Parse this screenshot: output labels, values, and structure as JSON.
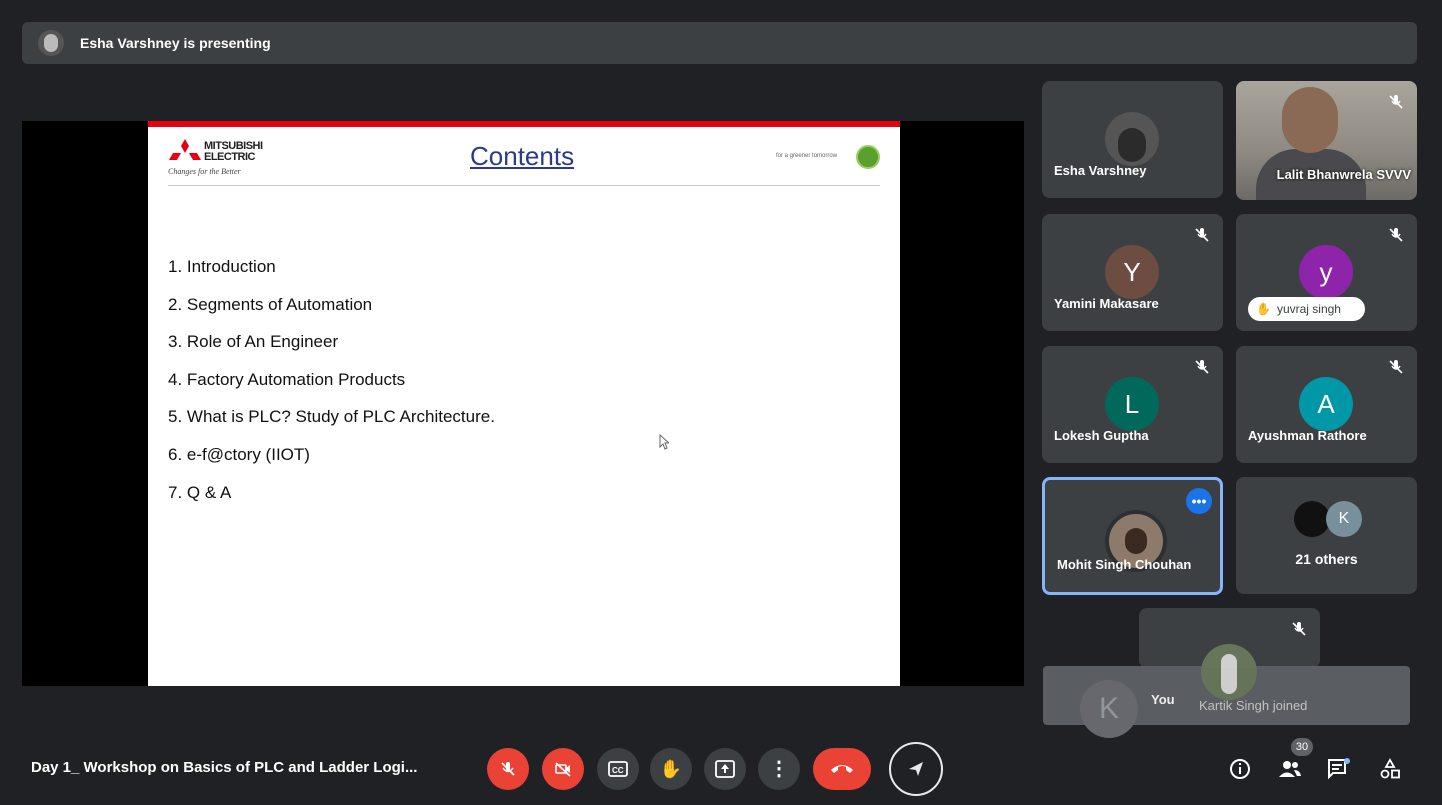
{
  "banner": {
    "presenting_text": "Esha Varshney is presenting"
  },
  "slide": {
    "logo_line1": "MITSUBISHI",
    "logo_line2": "ELECTRIC",
    "logo_tagline": "Changes for the Better",
    "title": "Contents",
    "eco_tagline": "for a greener tomorrow",
    "items": [
      "1. Introduction",
      "2. Segments of Automation",
      "3. Role of An Engineer",
      "4. Factory Automation Products",
      "5. What is PLC? Study of PLC Architecture.",
      "6. e-f@ctory (IIOT)",
      "7. Q & A"
    ]
  },
  "participants": {
    "esha": {
      "name": "Esha Varshney"
    },
    "lalit": {
      "name": "Lalit Bhanwrela SVVV"
    },
    "yamini": {
      "name": "Yamini Makasare",
      "initial": "Y",
      "color": "#6d4c41"
    },
    "yuvraj": {
      "name": "yuvraj singh",
      "initial": "y",
      "color": "#8e24aa"
    },
    "lokesh": {
      "name": "Lokesh Guptha",
      "initial": "L",
      "color": "#00695c"
    },
    "ayushman": {
      "name": "Ayushman Rathore",
      "initial": "A",
      "color": "#0097a7"
    },
    "mohit": {
      "name": "Mohit Singh Chouhan"
    },
    "others": {
      "label": "21 others",
      "initial": "K"
    },
    "self": {
      "label": "You",
      "initial": "K"
    }
  },
  "toast": {
    "text": "Kartik Singh joined"
  },
  "bottom": {
    "meeting_title": "Day 1_ Workshop on Basics of PLC and Ladder Logi...",
    "participant_count": "30"
  },
  "colors": {
    "accent": "#8ab4f8",
    "danger": "#ea4335",
    "surface": "#3c4043",
    "background": "#202124"
  }
}
